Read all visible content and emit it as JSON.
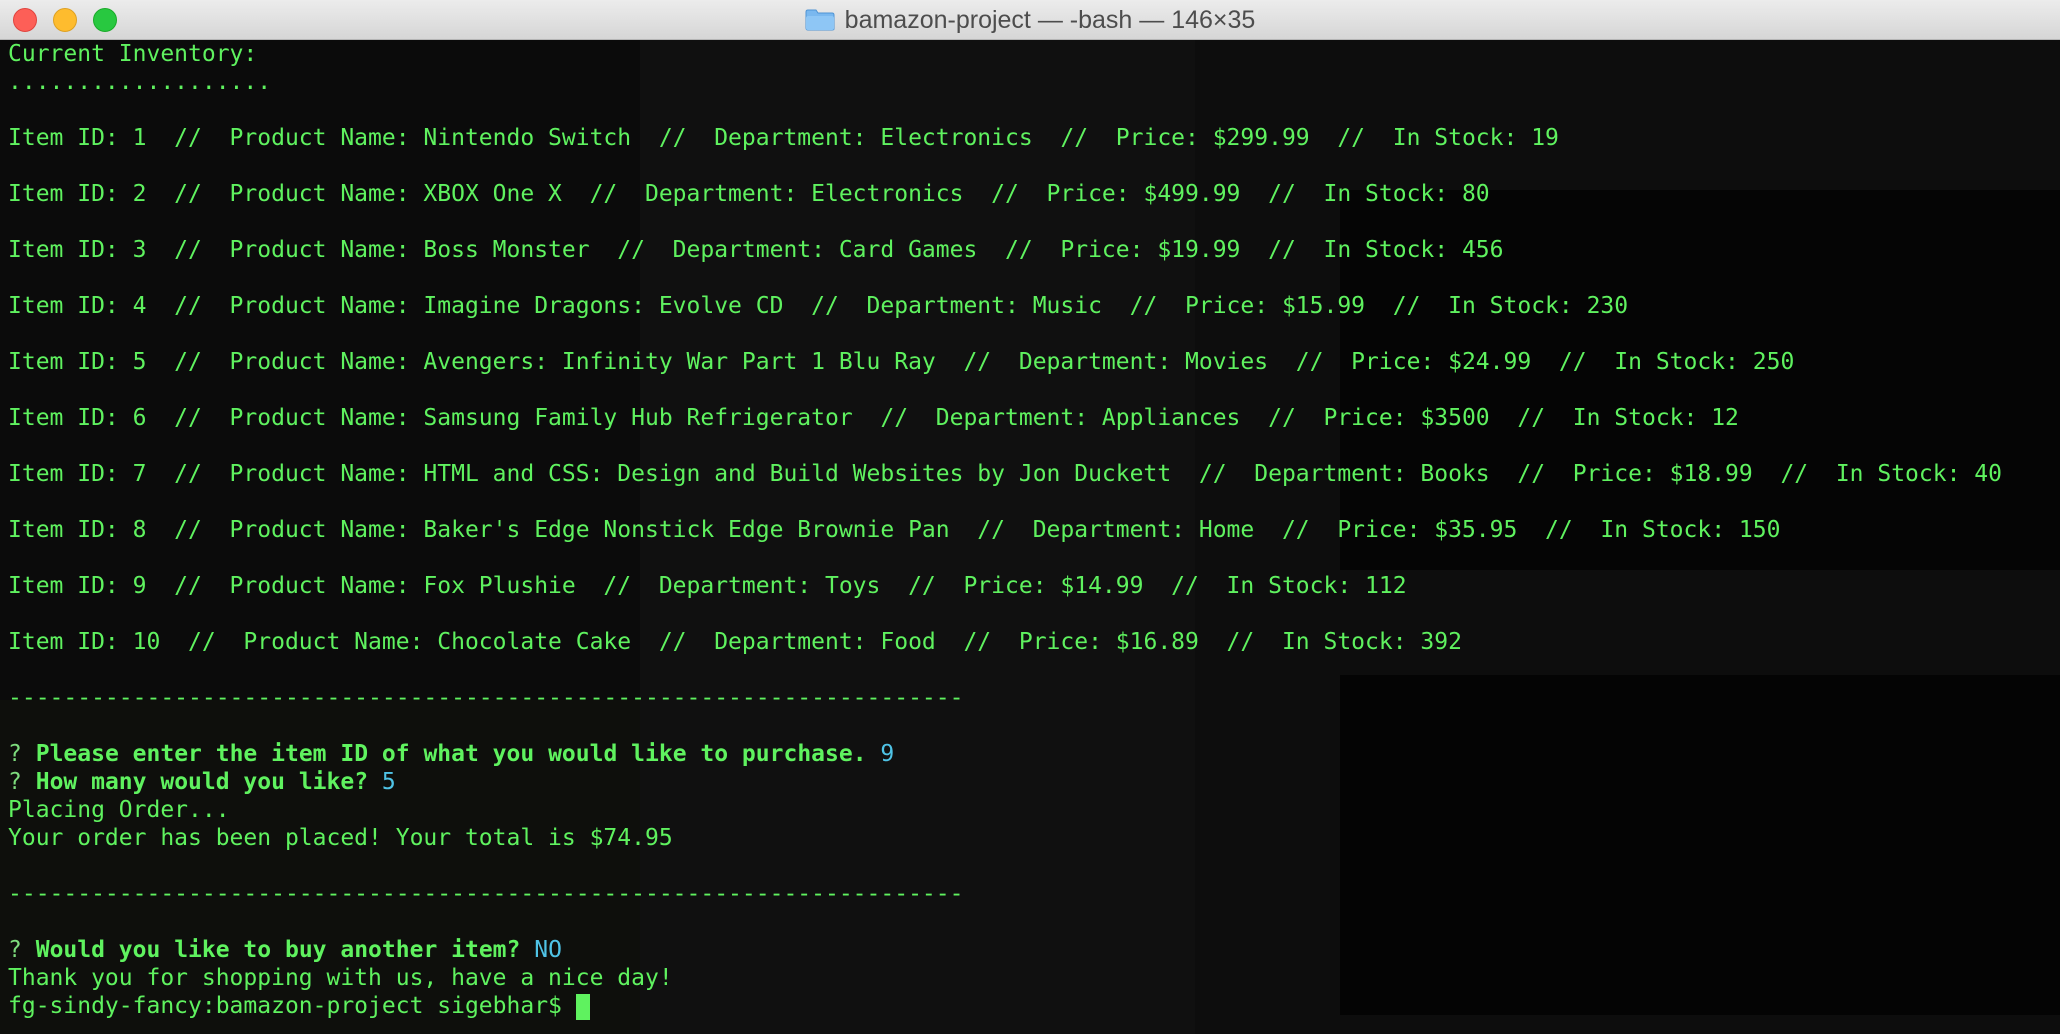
{
  "window": {
    "title": "bamazon-project — -bash — 146×35"
  },
  "terminal": {
    "header": "Current Inventory:",
    "dots": "...................",
    "items": [
      "Item ID: 1  //  Product Name: Nintendo Switch  //  Department: Electronics  //  Price: $299.99  //  In Stock: 19",
      "Item ID: 2  //  Product Name: XBOX One X  //  Department: Electronics  //  Price: $499.99  //  In Stock: 80",
      "Item ID: 3  //  Product Name: Boss Monster  //  Department: Card Games  //  Price: $19.99  //  In Stock: 456",
      "Item ID: 4  //  Product Name: Imagine Dragons: Evolve CD  //  Department: Music  //  Price: $15.99  //  In Stock: 230",
      "Item ID: 5  //  Product Name: Avengers: Infinity War Part 1 Blu Ray  //  Department: Movies  //  Price: $24.99  //  In Stock: 250",
      "Item ID: 6  //  Product Name: Samsung Family Hub Refrigerator  //  Department: Appliances  //  Price: $3500  //  In Stock: 12",
      "Item ID: 7  //  Product Name: HTML and CSS: Design and Build Websites by Jon Duckett  //  Department: Books  //  Price: $18.99  //  In Stock: 40",
      "Item ID: 8  //  Product Name: Baker's Edge Nonstick Edge Brownie Pan  //  Department: Home  //  Price: $35.95  //  In Stock: 150",
      "Item ID: 9  //  Product Name: Fox Plushie  //  Department: Toys  //  Price: $14.99  //  In Stock: 112",
      "Item ID: 10  //  Product Name: Chocolate Cake  //  Department: Food  //  Price: $16.89  //  In Stock: 392"
    ],
    "separator": "---------------------------------------------------------------------",
    "q1_mark": "?",
    "q1_text": "Please enter the item ID of what you would like to purchase.",
    "q1_answer": "9",
    "q2_mark": "?",
    "q2_text": "How many would you like?",
    "q2_answer": "5",
    "placing": "Placing Order...",
    "order_msg": "Your order has been placed! Your total is $74.95",
    "q3_mark": "?",
    "q3_text": "Would you like to buy another item?",
    "q3_answer": "NO",
    "thanks": "Thank you for shopping with us, have a nice day!",
    "prompt": "fg-sindy-fancy:bamazon-project sigebhar$"
  },
  "colors": {
    "text_green": "#5ff25f",
    "answer_cyan": "#4fc3e6",
    "title_bar": "#e0e0e0"
  }
}
